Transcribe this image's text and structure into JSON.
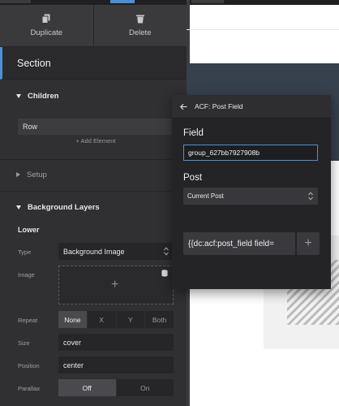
{
  "toolbar": {
    "duplicate_label": "Duplicate",
    "duplicate_icon": "copy-icon",
    "delete_label": "Delete",
    "delete_icon": "trash-icon"
  },
  "section": {
    "title": "Section"
  },
  "children_group": {
    "title": "Children",
    "items": [
      {
        "label": "Row"
      }
    ],
    "add_label": "+ Add Element"
  },
  "setup_group": {
    "title": "Setup"
  },
  "background_group": {
    "title": "Background Layers",
    "layer_title": "Lower",
    "type": {
      "label": "Type",
      "value": "Background Image"
    },
    "image": {
      "label": "Image",
      "add_icon": "plus-icon",
      "source_icon": "database-icon"
    },
    "repeat": {
      "label": "Repeat",
      "options": [
        "None",
        "X",
        "Y",
        "Both"
      ],
      "selected": "None"
    },
    "size": {
      "label": "Size",
      "value": "cover"
    },
    "position": {
      "label": "Position",
      "value": "center"
    },
    "parallax": {
      "label": "Parallax",
      "options": [
        "Off",
        "On"
      ],
      "selected": "Off"
    }
  },
  "popover": {
    "back_icon": "arrow-left-icon",
    "title": "ACF: Post Field",
    "field_label": "Field",
    "field_value": "group_627bb7927908b",
    "post_label": "Post",
    "post_value": "Current Post",
    "dynamic_tag": "{{dc:acf:post_field field=",
    "add_icon": "plus-icon"
  },
  "colors": {
    "panel_bg": "#303033",
    "accent_blue": "#4a90d9",
    "popover_bg": "#242427",
    "hero_bg": "#37414d"
  }
}
